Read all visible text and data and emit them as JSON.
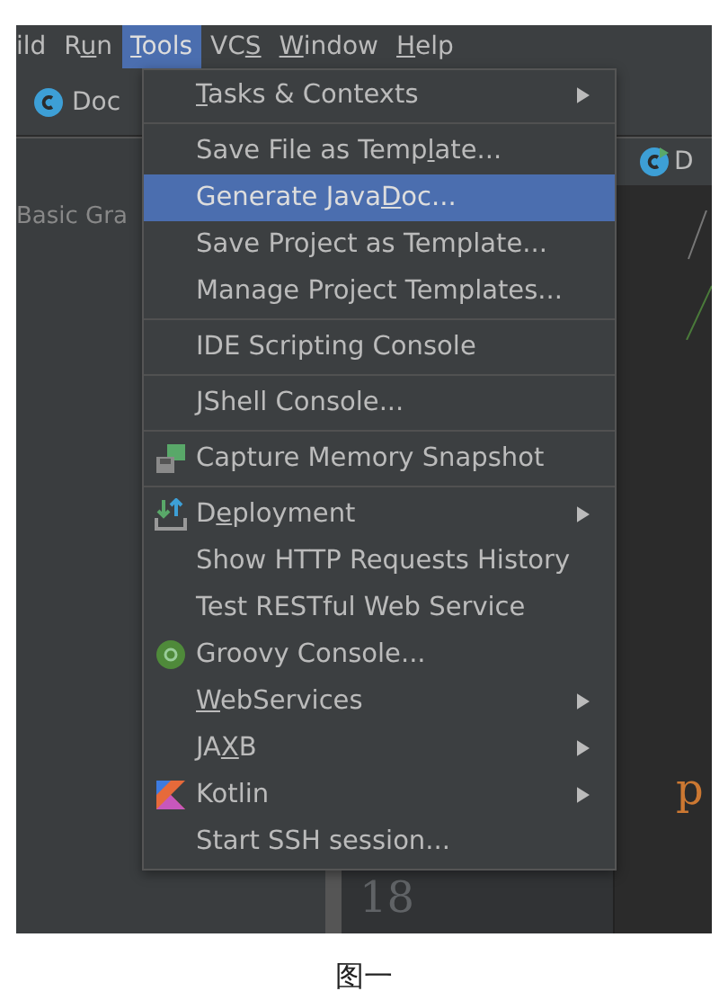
{
  "menubar": [
    {
      "label": [
        {
          "text": "ild"
        }
      ],
      "selected": false
    },
    {
      "label": [
        {
          "text": "R"
        },
        {
          "text": "u",
          "underlined": true
        },
        {
          "text": "n"
        }
      ],
      "selected": false
    },
    {
      "label": [
        {
          "text": "T",
          "underlined": true
        },
        {
          "text": "ools"
        }
      ],
      "selected": true
    },
    {
      "label": [
        {
          "text": "VC"
        },
        {
          "text": "S",
          "underlined": true
        }
      ],
      "selected": false
    },
    {
      "label": [
        {
          "text": "W",
          "underlined": true
        },
        {
          "text": "indow"
        }
      ],
      "selected": false
    },
    {
      "label": [
        {
          "text": "H",
          "underlined": true
        },
        {
          "text": "elp"
        }
      ],
      "selected": false
    }
  ],
  "breadcrumb": {
    "label": "Doc"
  },
  "left_panel": {
    "label": "Basic Gra"
  },
  "editor": {
    "tab": "D",
    "code": "p",
    "line_number": "18"
  },
  "tools_menu": [
    {
      "kind": "item",
      "label": [
        {
          "text": "T",
          "underlined": true
        },
        {
          "text": "asks & Contexts"
        }
      ],
      "submenu": true,
      "selected": false
    },
    {
      "kind": "separator"
    },
    {
      "kind": "item",
      "label": [
        {
          "text": "Save File as Temp"
        },
        {
          "text": "l",
          "underlined": true
        },
        {
          "text": "ate..."
        }
      ],
      "submenu": false,
      "selected": false
    },
    {
      "kind": "item",
      "label": [
        {
          "text": "Generate Java"
        },
        {
          "text": "D",
          "underlined": true
        },
        {
          "text": "oc..."
        }
      ],
      "submenu": false,
      "selected": true
    },
    {
      "kind": "item",
      "label": [
        {
          "text": "Save Project as Template..."
        }
      ],
      "submenu": false,
      "selected": false
    },
    {
      "kind": "item",
      "label": [
        {
          "text": "Manage Project Templates..."
        }
      ],
      "submenu": false,
      "selected": false
    },
    {
      "kind": "separator"
    },
    {
      "kind": "item",
      "label": [
        {
          "text": "IDE Scripting Console"
        }
      ],
      "submenu": false,
      "selected": false
    },
    {
      "kind": "separator"
    },
    {
      "kind": "item",
      "label": [
        {
          "text": "JShell Console..."
        }
      ],
      "submenu": false,
      "selected": false
    },
    {
      "kind": "separator"
    },
    {
      "kind": "memory",
      "label": [
        {
          "text": "Capture Memory Snapshot"
        }
      ],
      "submenu": false,
      "selected": false
    },
    {
      "kind": "separator"
    },
    {
      "kind": "deploy",
      "label": [
        {
          "text": "D"
        },
        {
          "text": "e",
          "underlined": true
        },
        {
          "text": "ployment"
        }
      ],
      "submenu": true,
      "selected": false
    },
    {
      "kind": "item",
      "label": [
        {
          "text": "Show HTTP Requests History"
        }
      ],
      "submenu": false,
      "selected": false
    },
    {
      "kind": "item",
      "label": [
        {
          "text": "Test RESTful Web Service"
        }
      ],
      "submenu": false,
      "selected": false
    },
    {
      "kind": "groovy",
      "label": [
        {
          "text": "Groovy Console..."
        }
      ],
      "submenu": false,
      "selected": false
    },
    {
      "kind": "item",
      "label": [
        {
          "text": "W",
          "underlined": true
        },
        {
          "text": "ebServices"
        }
      ],
      "submenu": true,
      "selected": false
    },
    {
      "kind": "item",
      "label": [
        {
          "text": "JA"
        },
        {
          "text": "X",
          "underlined": true
        },
        {
          "text": "B"
        }
      ],
      "submenu": true,
      "selected": false
    },
    {
      "kind": "kotlin",
      "label": [
        {
          "text": "Kotlin"
        }
      ],
      "submenu": true,
      "selected": false
    },
    {
      "kind": "item",
      "label": [
        {
          "text": "Start SSH session..."
        }
      ],
      "submenu": false,
      "selected": false
    }
  ],
  "caption": "图一"
}
